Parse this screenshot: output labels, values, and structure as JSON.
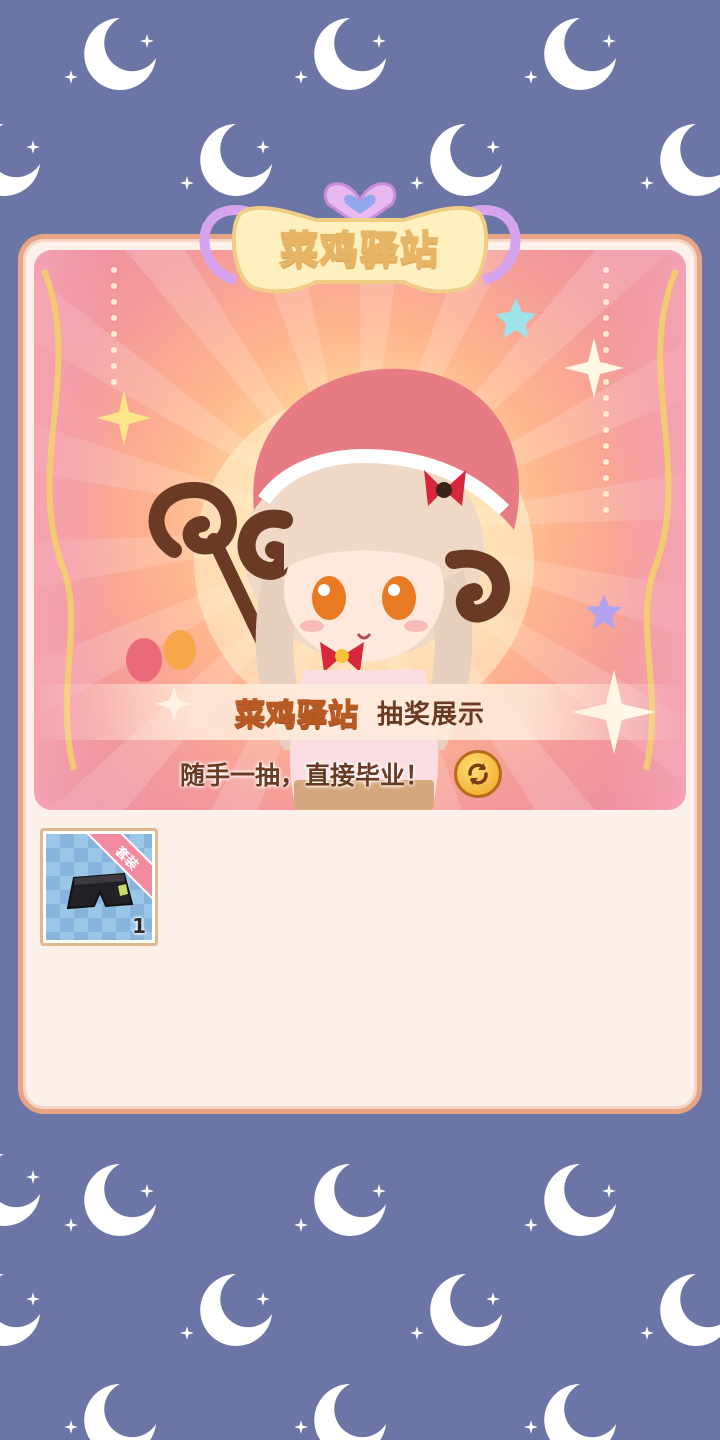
{
  "title": "菜鸡驿站",
  "banner": {
    "name": "菜鸡驿站",
    "tag": "抽奖展示",
    "slogan": "随手一抽，直接毕业！"
  },
  "items": [
    {
      "name_icon": "black-shorts-icon",
      "badge": "套装",
      "count": "1"
    }
  ],
  "colors": {
    "background": "#6b76a6",
    "panel": "#fbf1ea",
    "panel_border": "#e7a585",
    "title_gold": "#ffcf43"
  }
}
